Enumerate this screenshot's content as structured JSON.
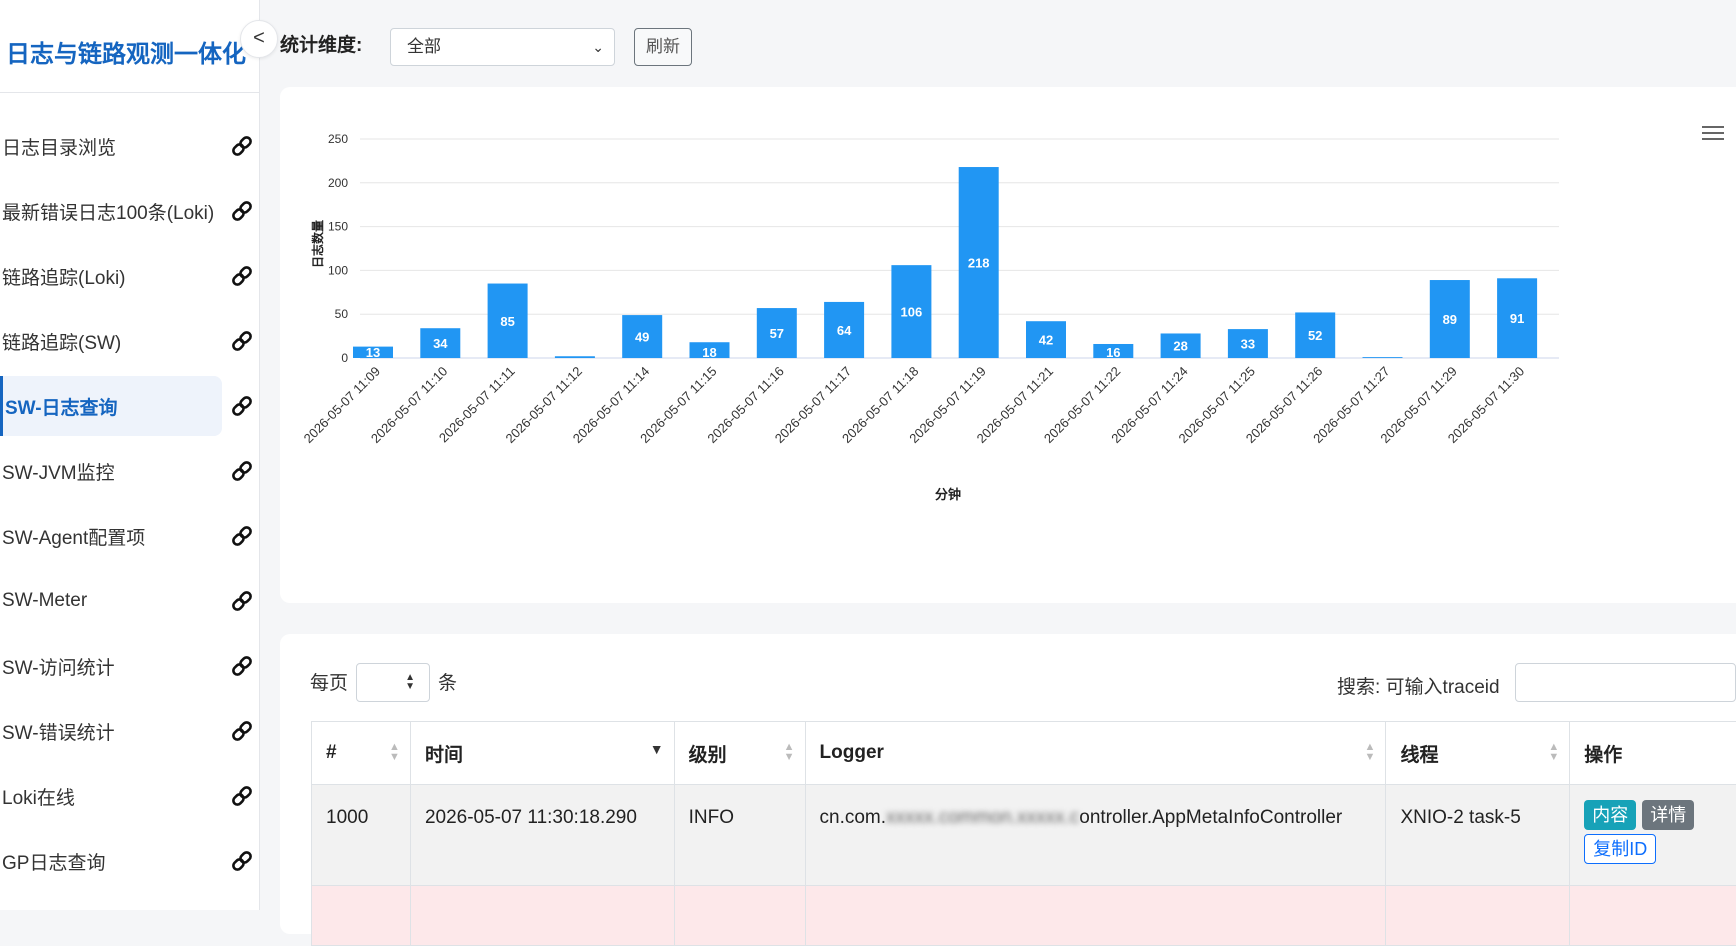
{
  "sidebar": {
    "brand": "日志与链路观测一体化",
    "collapse_glyph": "<",
    "items": [
      {
        "label": "日志目录浏览",
        "icon": "link-icon",
        "active": false
      },
      {
        "label": "最新错误日志100条(Loki)",
        "icon": "link-icon",
        "active": false
      },
      {
        "label": "链路追踪(Loki)",
        "icon": "link-icon",
        "active": false
      },
      {
        "label": "链路追踪(SW)",
        "icon": "link-icon",
        "active": false
      },
      {
        "label": "SW-日志查询",
        "icon": "link-icon",
        "active": true
      },
      {
        "label": "SW-JVM监控",
        "icon": "link-icon",
        "active": false
      },
      {
        "label": "SW-Agent配置项",
        "icon": "link-icon",
        "active": false
      },
      {
        "label": "SW-Meter",
        "icon": "link-icon",
        "active": false
      },
      {
        "label": "SW-访问统计",
        "icon": "link-icon",
        "active": false
      },
      {
        "label": "SW-错误统计",
        "icon": "link-icon",
        "active": false
      },
      {
        "label": "Loki在线",
        "icon": "link-icon",
        "active": false
      },
      {
        "label": "GP日志查询",
        "icon": "link-icon",
        "active": false
      }
    ]
  },
  "toolbar": {
    "dimension_label": "统计维度:",
    "dimension_value": "全部",
    "refresh_label": "刷新"
  },
  "chart_data": {
    "type": "bar",
    "categories": [
      "2026-05-07 11:09",
      "2026-05-07 11:10",
      "2026-05-07 11:11",
      "2026-05-07 11:12",
      "2026-05-07 11:14",
      "2026-05-07 11:15",
      "2026-05-07 11:16",
      "2026-05-07 11:17",
      "2026-05-07 11:18",
      "2026-05-07 11:19",
      "2026-05-07 11:21",
      "2026-05-07 11:22",
      "2026-05-07 11:24",
      "2026-05-07 11:25",
      "2026-05-07 11:26",
      "2026-05-07 11:27",
      "2026-05-07 11:29",
      "2026-05-07 11:30"
    ],
    "values": [
      13,
      34,
      85,
      2,
      49,
      18,
      57,
      64,
      106,
      218,
      42,
      16,
      28,
      33,
      52,
      1,
      89,
      91
    ],
    "value_labels": [
      "13",
      "34",
      "85",
      "",
      "49",
      "18",
      "57",
      "64",
      "106",
      "218",
      "42",
      "16",
      "28",
      "33",
      "52",
      "",
      "89",
      "91"
    ],
    "yticks": [
      0,
      50,
      100,
      150,
      200,
      250
    ],
    "ylim": [
      0,
      250
    ],
    "xlabel": "分钟",
    "ylabel": "日志数量",
    "bar_color": "#2196f3",
    "grid": true,
    "legend": false
  },
  "table": {
    "per_page_label": "每页",
    "per_page_suffix": "条",
    "search_label": "搜索: 可输入traceid",
    "columns": [
      "#",
      "时间",
      "级别",
      "Logger",
      "线程",
      "操作"
    ],
    "rows": [
      {
        "id": "1000",
        "time": "2026-05-07 11:30:18.290",
        "level": "INFO",
        "logger_prefix": "cn.com.",
        "logger_redacted": "xxxxx.common.xxxxx.c",
        "logger_suffix": "ontroller.AppMetaInfoController",
        "thread": "XNIO-2 task-5",
        "actions": [
          "内容",
          "详情",
          "复制ID"
        ]
      }
    ],
    "sorted_column": "时间",
    "sort_direction": "desc",
    "error_row_color": "#fde8ea"
  }
}
